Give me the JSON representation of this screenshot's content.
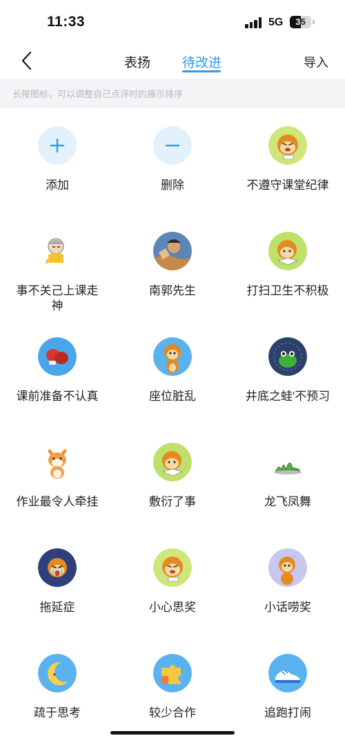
{
  "status_bar": {
    "time": "11:33",
    "network": "5G",
    "battery": "35"
  },
  "nav": {
    "tabs": [
      {
        "label": "表扬",
        "active": false
      },
      {
        "label": "待改进",
        "active": true
      }
    ],
    "import_label": "导入",
    "accent_color": "#2f9be8"
  },
  "hint": "长按图标，可以调整自己点评时的展示排序",
  "items": [
    {
      "label": "添加",
      "icon": "plus-icon"
    },
    {
      "label": "删除",
      "icon": "minus-icon"
    },
    {
      "label": "不遵守课堂纪律",
      "icon": "monkey-angry-icon"
    },
    {
      "label": "事不关己上课走神",
      "icon": "cartoon-boy-icon"
    },
    {
      "label": "南郭先生",
      "icon": "portrait-icon"
    },
    {
      "label": "打扫卫生不积极",
      "icon": "monkey-reading-icon"
    },
    {
      "label": "课前准备不认真",
      "icon": "boxing-gloves-icon"
    },
    {
      "label": "座位脏乱",
      "icon": "monkey-icon"
    },
    {
      "label": "井底之蛙'不预习",
      "icon": "frog-in-well-icon"
    },
    {
      "label": "作业最令人牵挂",
      "icon": "shiba-dog-icon"
    },
    {
      "label": "敷衍了事",
      "icon": "monkey-reading-icon"
    },
    {
      "label": "龙飞凤舞",
      "icon": "grass-icon"
    },
    {
      "label": "拖延症",
      "icon": "monkey-crying-icon"
    },
    {
      "label": "小心思奖",
      "icon": "monkey-angry-icon"
    },
    {
      "label": "小话唠奖",
      "icon": "monkey-chatting-icon"
    },
    {
      "label": "疏于思考",
      "icon": "moon-icon"
    },
    {
      "label": "较少合作",
      "icon": "puzzle-icon"
    },
    {
      "label": "追跑打闹",
      "icon": "running-shoe-icon"
    }
  ]
}
